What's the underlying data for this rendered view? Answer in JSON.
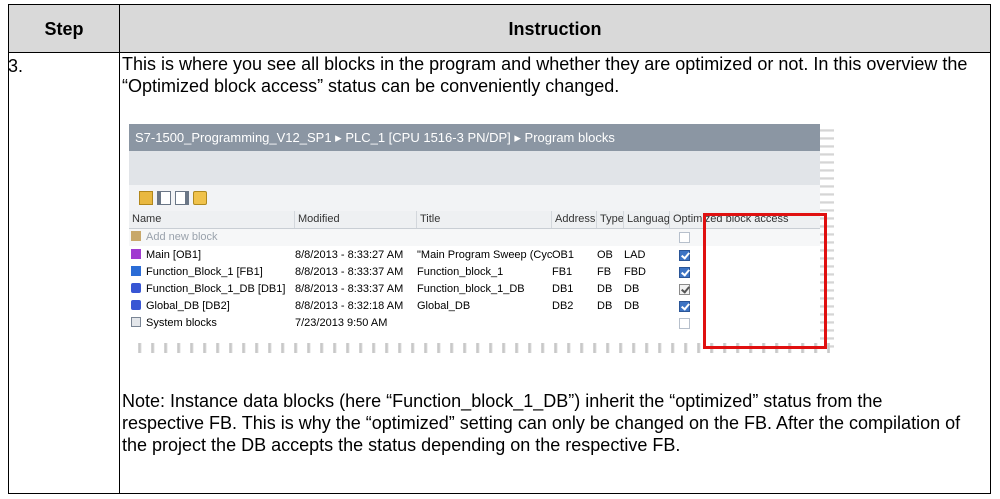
{
  "table": {
    "header_step": "Step",
    "header_instruction": "Instruction",
    "step_number": "3.",
    "paragraph": "This is where you see all blocks in the program and whether they are optimized or not. In this overview the “Optimized block access” status can be conveniently changed.",
    "note": "Note: Instance data blocks (here “Function_block_1_DB”) inherit the “optimized” status from the respective FB. This is why the “optimized” setting can only be changed on the FB. After the compilation of the project the DB accepts the status depending on the respective FB."
  },
  "screenshot": {
    "breadcrumb": "S7-1500_Programming_V12_SP1  ▸  PLC_1 [CPU 1516-3 PN/DP]  ▸  Program blocks",
    "toolbar_icons": [
      "folder-icon",
      "split-left-icon",
      "split-right-icon",
      "eye-icon"
    ],
    "columns": {
      "name": "Name",
      "modified": "Modified",
      "title": "Title",
      "address": "Address",
      "type": "Type",
      "language": "Language",
      "optimized": "Optimized block access"
    },
    "add_new": "Add new block",
    "rows": [
      {
        "name": "Main [OB1]",
        "modified": "8/8/2013 - 8:33:27 AM",
        "title": "\"Main Program Sweep (Cycle)\"",
        "address": "OB1",
        "type": "OB",
        "language": "LAD",
        "optimized": "checked",
        "icon": "ob-icon"
      },
      {
        "name": "Function_Block_1 [FB1]",
        "modified": "8/8/2013 - 8:33:37 AM",
        "title": "Function_block_1",
        "address": "FB1",
        "type": "FB",
        "language": "FBD",
        "optimized": "checked",
        "icon": "fb-icon"
      },
      {
        "name": "Function_Block_1_DB [DB1]",
        "modified": "8/8/2013 - 8:33:37 AM",
        "title": "Function_block_1_DB",
        "address": "DB1",
        "type": "DB",
        "language": "DB",
        "optimized": "checked-readonly",
        "icon": "db-icon"
      },
      {
        "name": "Global_DB [DB2]",
        "modified": "8/8/2013 - 8:32:18 AM",
        "title": "Global_DB",
        "address": "DB2",
        "type": "DB",
        "language": "DB",
        "optimized": "checked",
        "icon": "db-icon"
      },
      {
        "name": "System blocks",
        "modified": "7/23/2013 9:50 AM",
        "title": "",
        "address": "",
        "type": "",
        "language": "",
        "optimized": "unchecked",
        "icon": "system-blocks-icon"
      }
    ],
    "highlight_color": "#e01010"
  }
}
